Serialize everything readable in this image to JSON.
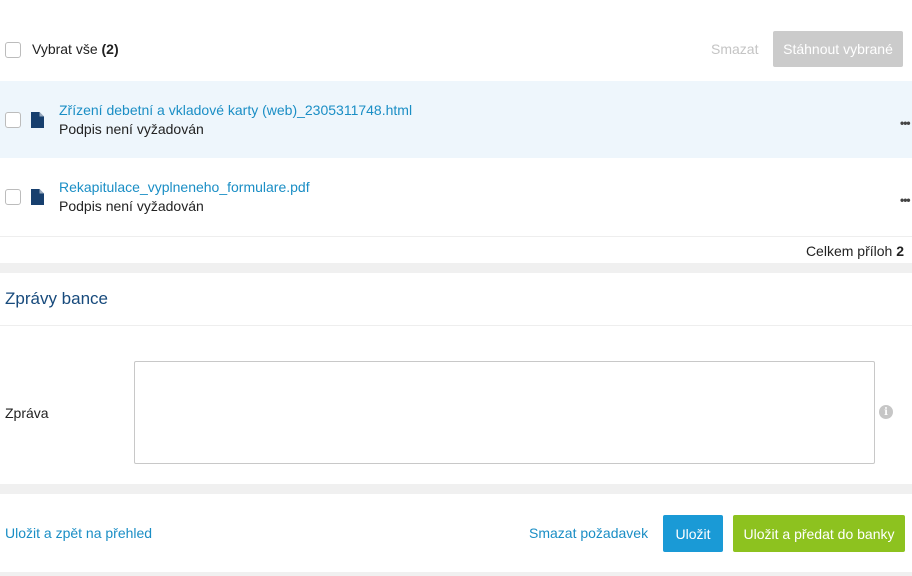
{
  "attachments": {
    "select_all_label": "Vybrat vše",
    "select_all_count": "(2)",
    "delete_label": "Smazat",
    "download_selected_label": "Stáhnout vybrané",
    "files": [
      {
        "name": "Zřízení debetní a vkladové karty (web)_2305311748.html",
        "status": "Podpis není vyžadován",
        "more_icon": "ellipsis-icon"
      },
      {
        "name": "Rekapitulace_vyplneneho_formulare.pdf",
        "status": "Podpis není vyžadován",
        "more_icon": "ellipsis-icon"
      }
    ],
    "total_label": "Celkem příloh",
    "total_count": "2"
  },
  "bank_messages": {
    "title": "Zprávy bance",
    "message_label": "Zpráva",
    "message_value": "",
    "info_icon": "info-icon"
  },
  "actions": {
    "save_and_back": "Uložit a zpět na přehled",
    "delete_request": "Smazat požadavek",
    "save": "Uložit",
    "save_and_submit": "Uložit a předat do banky"
  },
  "colors": {
    "link": "#1a8ec5",
    "primary_button": "#1a9ad6",
    "submit_button": "#8dc21f",
    "disabled_button": "#cbcbcb",
    "title": "#174a7c",
    "row_highlight": "#eef6fc"
  }
}
